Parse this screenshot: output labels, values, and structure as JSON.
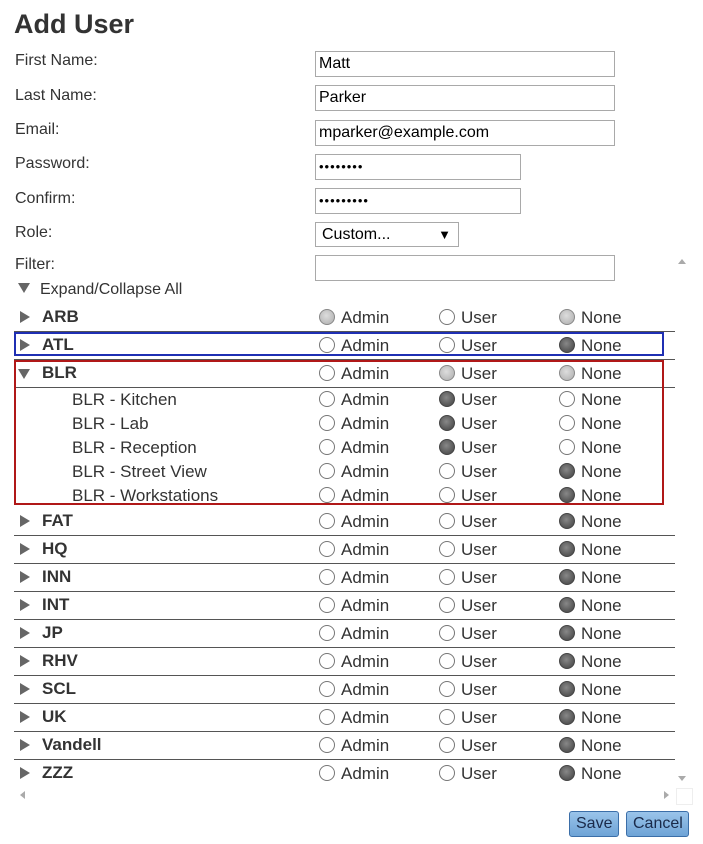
{
  "page": {
    "title": "Add User"
  },
  "form": {
    "first_name": {
      "label": "First Name:",
      "value": "Matt"
    },
    "last_name": {
      "label": "Last Name:",
      "value": "Parker"
    },
    "email": {
      "label": "Email:",
      "value": "mparker@example.com"
    },
    "password": {
      "label": "Password:",
      "value": "••••••••"
    },
    "confirm": {
      "label": "Confirm:",
      "value": "•••••••••"
    },
    "role": {
      "label": "Role:",
      "value": "Custom...",
      "arrow": "▼"
    },
    "filter": {
      "label": "Filter:",
      "value": ""
    }
  },
  "tree": {
    "expand_all": "Expand/Collapse All",
    "option_labels": {
      "admin": "Admin",
      "user": "User",
      "none": "None"
    },
    "rows": [
      {
        "label": "ARB",
        "kind": "group",
        "expanded": false,
        "selected": "partial-admin-none"
      },
      {
        "label": "ATL",
        "kind": "group",
        "expanded": false,
        "selected": "none"
      },
      {
        "label": "BLR",
        "kind": "group",
        "expanded": true,
        "selected": "partial-user-none"
      },
      {
        "label": "BLR - Kitchen",
        "kind": "child",
        "selected": "user"
      },
      {
        "label": "BLR - Lab",
        "kind": "child",
        "selected": "user"
      },
      {
        "label": "BLR - Reception",
        "kind": "child",
        "selected": "user"
      },
      {
        "label": "BLR - Street View",
        "kind": "child",
        "selected": "none"
      },
      {
        "label": "BLR - Workstations",
        "kind": "child",
        "selected": "none"
      },
      {
        "label": "FAT",
        "kind": "group",
        "expanded": false,
        "selected": "none"
      },
      {
        "label": "HQ",
        "kind": "group",
        "expanded": false,
        "selected": "none"
      },
      {
        "label": "INN",
        "kind": "group",
        "expanded": false,
        "selected": "none"
      },
      {
        "label": "INT",
        "kind": "group",
        "expanded": false,
        "selected": "none"
      },
      {
        "label": "JP",
        "kind": "group",
        "expanded": false,
        "selected": "none"
      },
      {
        "label": "RHV",
        "kind": "group",
        "expanded": false,
        "selected": "none"
      },
      {
        "label": "SCL",
        "kind": "group",
        "expanded": false,
        "selected": "none"
      },
      {
        "label": "UK",
        "kind": "group",
        "expanded": false,
        "selected": "none"
      },
      {
        "label": "Vandell",
        "kind": "group",
        "expanded": false,
        "selected": "none"
      },
      {
        "label": "ZZZ",
        "kind": "group",
        "expanded": false,
        "selected": "none"
      }
    ]
  },
  "buttons": {
    "save": "Save",
    "cancel": "Cancel"
  },
  "colors": {
    "highlight_blue": "#1f2fb3",
    "highlight_red": "#b01818",
    "button": "#7fb0dd"
  }
}
